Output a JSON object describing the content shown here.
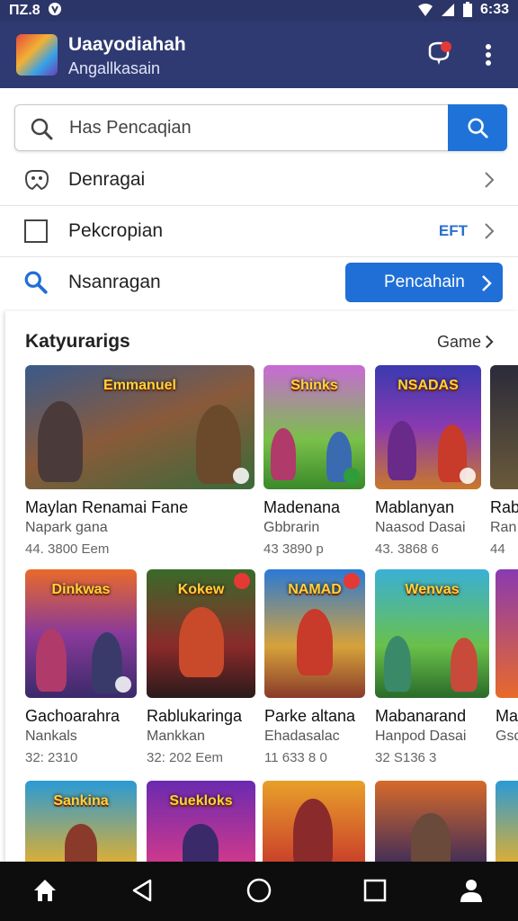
{
  "status": {
    "time_left": "ΠΖ.8",
    "time_right": "6:33"
  },
  "appbar": {
    "title": "Uaayodiahah",
    "subtitle": "Angallkasain"
  },
  "search": {
    "placeholder": "Has Pencaqian"
  },
  "rows": [
    {
      "label": "Denragai"
    },
    {
      "label": "Pekcropian",
      "tag": "EFT"
    },
    {
      "label": "Nsanragan",
      "button": "Pencahain"
    }
  ],
  "section": {
    "title": "Katyurarigs",
    "more": "Game"
  },
  "cards": [
    {
      "title": "Maylan Renamai Fane",
      "sub": "Napark gana",
      "meta": "44. 3800 Eem",
      "art": "Emmanuel"
    },
    {
      "title": "Madenana",
      "sub": "Gbbrarin",
      "meta": "43 3890 p",
      "art": "Shinks"
    },
    {
      "title": "Mablanyan",
      "sub": "Naasod Dasai",
      "meta": "43. 3868 6",
      "art": "NSADAS"
    },
    {
      "title": "Rab",
      "sub": "Ran",
      "meta": "44",
      "art": ""
    },
    {
      "title": "Gachoarahra",
      "sub": "Nankals",
      "meta": "32: 2310",
      "art": "Dinkwas"
    },
    {
      "title": "Rablukaringa",
      "sub": "Mankkan",
      "meta": "32: 202 Eem",
      "art": "Kokew"
    },
    {
      "title": "Parke altana",
      "sub": "Ehadasalac",
      "meta": "11 633 8 0",
      "art": "NAMAD"
    },
    {
      "title": "Mabanarand",
      "sub": "Hanpod Dasai",
      "meta": "32 S136 3",
      "art": "Wenvas"
    },
    {
      "title": "Ma",
      "sub": "Gsd",
      "meta": "",
      "art": ""
    },
    {
      "title": "",
      "sub": "",
      "meta": "",
      "art": "Sankina"
    },
    {
      "title": "",
      "sub": "",
      "meta": "",
      "art": "Suekloks"
    },
    {
      "title": "",
      "sub": "",
      "meta": "",
      "art": ""
    },
    {
      "title": "",
      "sub": "",
      "meta": "",
      "art": ""
    },
    {
      "title": "",
      "sub": "",
      "meta": "",
      "art": ""
    }
  ],
  "colors": {
    "appbar": "#2f3a72",
    "statusbar": "#2c3568",
    "accent": "#1f73d8",
    "navbar": "#0d0d0d"
  },
  "icons": [
    "wifi-icon",
    "signal-icon",
    "battery-icon",
    "notification-bell-icon",
    "more-vert-icon",
    "search-icon",
    "game-icon",
    "square-icon",
    "chevron-right-icon",
    "home-icon",
    "back-icon",
    "circle-home-icon",
    "recents-icon",
    "profile-icon"
  ]
}
